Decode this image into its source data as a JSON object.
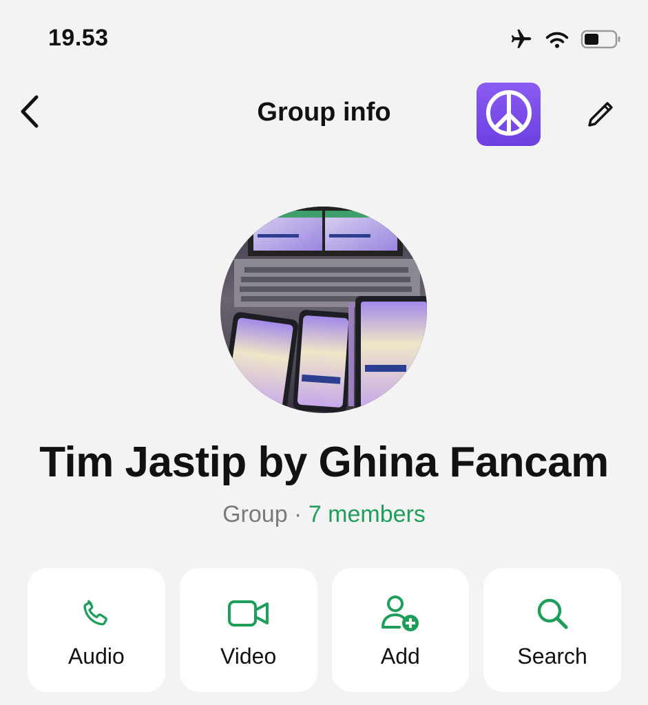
{
  "status_bar": {
    "time": "19.53",
    "icons": [
      "airplane-icon",
      "wifi-icon",
      "battery-icon"
    ]
  },
  "nav": {
    "title": "Group info",
    "back_icon": "chevron-left-icon",
    "badge_icon": "peace-symbol-icon",
    "edit_icon": "pencil-icon"
  },
  "group": {
    "name": "Tim Jastip by Ghina Fancam",
    "type_label": "Group",
    "separator": " · ",
    "members_label": "7 members"
  },
  "actions": [
    {
      "label": "Audio",
      "icon": "phone-icon"
    },
    {
      "label": "Video",
      "icon": "video-camera-icon"
    },
    {
      "label": "Add",
      "icon": "add-person-icon"
    },
    {
      "label": "Search",
      "icon": "search-icon"
    }
  ],
  "colors": {
    "accent_green": "#1e9e5a",
    "badge_purple": "#7a4ae8",
    "background": "#f3f3f3"
  }
}
